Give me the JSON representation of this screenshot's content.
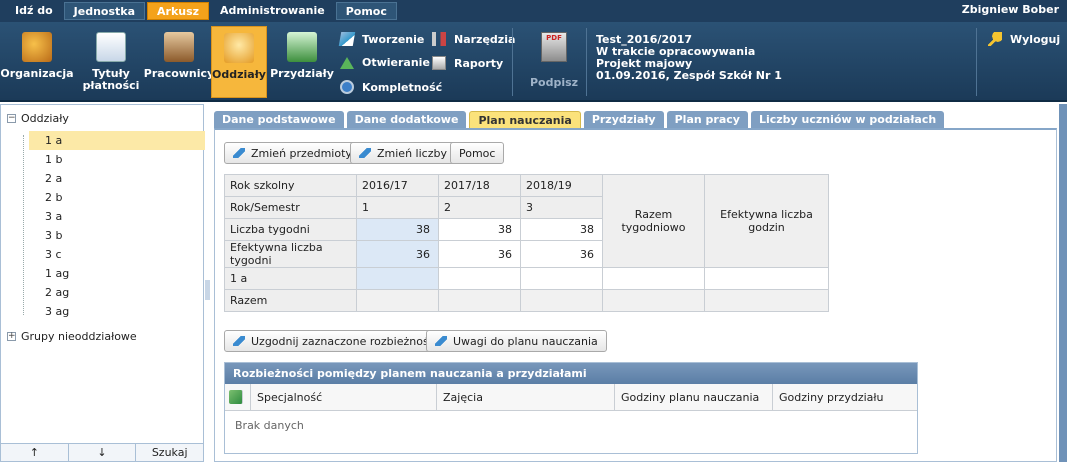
{
  "menu": {
    "items": [
      "Idź do",
      "Jednostka",
      "Arkusz",
      "Administrowanie",
      "Pomoc"
    ],
    "active": "Arkusz",
    "user": "Zbigniew Bober"
  },
  "ribbon": {
    "organizacja": "Organizacja",
    "tytuly_line1": "Tytuły",
    "tytuly_line2": "płatności",
    "pracownicy": "Pracownicy",
    "oddzialy": "Oddziały",
    "przydzialy": "Przydziały",
    "tworzenie": "Tworzenie",
    "otwieranie": "Otwieranie",
    "kompletnosc": "Kompletność",
    "narzedzia": "Narzędzia",
    "raporty": "Raporty",
    "podpisz": "Podpisz",
    "pdf_label": "PDF",
    "info": [
      "Test_2016/2017",
      "W trakcie opracowywania",
      "Projekt majowy",
      "01.09.2016, Zespół Szkół Nr 1"
    ],
    "wyloguj": "Wyloguj"
  },
  "tree": {
    "root": "Oddziały",
    "items": [
      "1 a",
      "1 b",
      "2 a",
      "2 b",
      "3 a",
      "3 b",
      "3 c",
      "1 ag",
      "2 ag",
      "3 ag"
    ],
    "selected": "1 a",
    "group": "Grupy nieoddziałowe",
    "footer_up": "↑",
    "footer_down": "↓",
    "footer_search": "Szukaj"
  },
  "tabs": [
    "Dane podstawowe",
    "Dane dodatkowe",
    "Plan nauczania",
    "Przydziały",
    "Plan pracy",
    "Liczby uczniów w podziałach"
  ],
  "active_tab": "Plan nauczania",
  "toolbar": {
    "zmien_przedmioty": "Zmień przedmioty",
    "zmien_liczby": "Zmień liczby",
    "pomoc": "Pomoc"
  },
  "plan": {
    "rok_szkolny_label": "Rok szkolny",
    "years": [
      "2016/17",
      "2017/18",
      "2018/19"
    ],
    "rok_semestr_label": "Rok/Semestr",
    "semesters": [
      "1",
      "2",
      "3"
    ],
    "liczba_tygodni_label": "Liczba tygodni",
    "liczba_tygodni": [
      "38",
      "38",
      "38"
    ],
    "efektywna_label": "Efektywna liczba tygodni",
    "efektywna": [
      "36",
      "36",
      "36"
    ],
    "razem_tygodniowo": "Razem tygodniowo",
    "efektywna_godzin": "Efektywna liczba godzin",
    "row_class": "1 a",
    "row_razem": "Razem"
  },
  "actions": {
    "uzgodnij": "Uzgodnij zaznaczone rozbieżności",
    "uwagi": "Uwagi do planu nauczania"
  },
  "discrepancies": {
    "title": "Rozbieżności pomiędzy planem nauczania a przydziałami",
    "columns": [
      "Specjalność",
      "Zajęcia",
      "Godziny planu nauczania",
      "Godziny przydziału"
    ],
    "empty": "Brak danych"
  }
}
